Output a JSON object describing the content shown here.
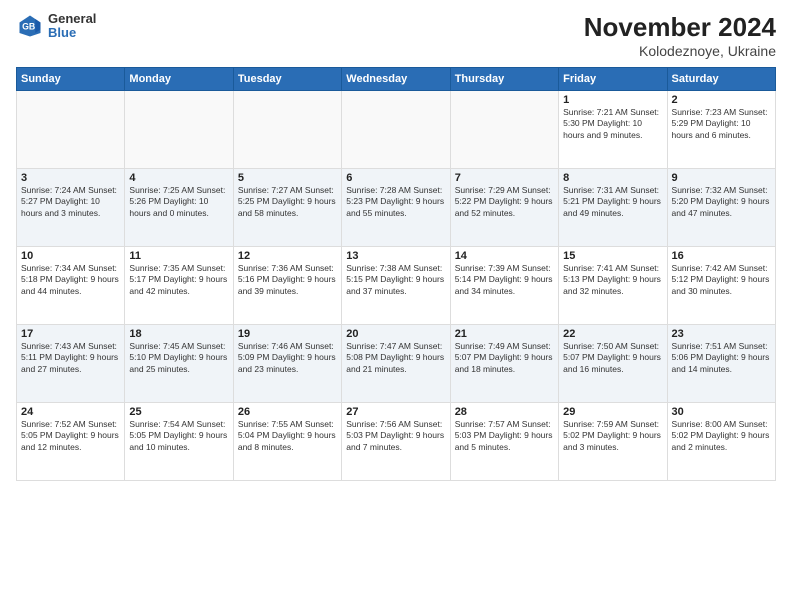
{
  "header": {
    "logo": {
      "general": "General",
      "blue": "Blue"
    },
    "title": "November 2024",
    "subtitle": "Kolodeznoye, Ukraine"
  },
  "days_of_week": [
    "Sunday",
    "Monday",
    "Tuesday",
    "Wednesday",
    "Thursday",
    "Friday",
    "Saturday"
  ],
  "weeks": [
    [
      {
        "day": "",
        "info": ""
      },
      {
        "day": "",
        "info": ""
      },
      {
        "day": "",
        "info": ""
      },
      {
        "day": "",
        "info": ""
      },
      {
        "day": "",
        "info": ""
      },
      {
        "day": "1",
        "info": "Sunrise: 7:21 AM\nSunset: 5:30 PM\nDaylight: 10 hours and 9 minutes."
      },
      {
        "day": "2",
        "info": "Sunrise: 7:23 AM\nSunset: 5:29 PM\nDaylight: 10 hours and 6 minutes."
      }
    ],
    [
      {
        "day": "3",
        "info": "Sunrise: 7:24 AM\nSunset: 5:27 PM\nDaylight: 10 hours and 3 minutes."
      },
      {
        "day": "4",
        "info": "Sunrise: 7:25 AM\nSunset: 5:26 PM\nDaylight: 10 hours and 0 minutes."
      },
      {
        "day": "5",
        "info": "Sunrise: 7:27 AM\nSunset: 5:25 PM\nDaylight: 9 hours and 58 minutes."
      },
      {
        "day": "6",
        "info": "Sunrise: 7:28 AM\nSunset: 5:23 PM\nDaylight: 9 hours and 55 minutes."
      },
      {
        "day": "7",
        "info": "Sunrise: 7:29 AM\nSunset: 5:22 PM\nDaylight: 9 hours and 52 minutes."
      },
      {
        "day": "8",
        "info": "Sunrise: 7:31 AM\nSunset: 5:21 PM\nDaylight: 9 hours and 49 minutes."
      },
      {
        "day": "9",
        "info": "Sunrise: 7:32 AM\nSunset: 5:20 PM\nDaylight: 9 hours and 47 minutes."
      }
    ],
    [
      {
        "day": "10",
        "info": "Sunrise: 7:34 AM\nSunset: 5:18 PM\nDaylight: 9 hours and 44 minutes."
      },
      {
        "day": "11",
        "info": "Sunrise: 7:35 AM\nSunset: 5:17 PM\nDaylight: 9 hours and 42 minutes."
      },
      {
        "day": "12",
        "info": "Sunrise: 7:36 AM\nSunset: 5:16 PM\nDaylight: 9 hours and 39 minutes."
      },
      {
        "day": "13",
        "info": "Sunrise: 7:38 AM\nSunset: 5:15 PM\nDaylight: 9 hours and 37 minutes."
      },
      {
        "day": "14",
        "info": "Sunrise: 7:39 AM\nSunset: 5:14 PM\nDaylight: 9 hours and 34 minutes."
      },
      {
        "day": "15",
        "info": "Sunrise: 7:41 AM\nSunset: 5:13 PM\nDaylight: 9 hours and 32 minutes."
      },
      {
        "day": "16",
        "info": "Sunrise: 7:42 AM\nSunset: 5:12 PM\nDaylight: 9 hours and 30 minutes."
      }
    ],
    [
      {
        "day": "17",
        "info": "Sunrise: 7:43 AM\nSunset: 5:11 PM\nDaylight: 9 hours and 27 minutes."
      },
      {
        "day": "18",
        "info": "Sunrise: 7:45 AM\nSunset: 5:10 PM\nDaylight: 9 hours and 25 minutes."
      },
      {
        "day": "19",
        "info": "Sunrise: 7:46 AM\nSunset: 5:09 PM\nDaylight: 9 hours and 23 minutes."
      },
      {
        "day": "20",
        "info": "Sunrise: 7:47 AM\nSunset: 5:08 PM\nDaylight: 9 hours and 21 minutes."
      },
      {
        "day": "21",
        "info": "Sunrise: 7:49 AM\nSunset: 5:07 PM\nDaylight: 9 hours and 18 minutes."
      },
      {
        "day": "22",
        "info": "Sunrise: 7:50 AM\nSunset: 5:07 PM\nDaylight: 9 hours and 16 minutes."
      },
      {
        "day": "23",
        "info": "Sunrise: 7:51 AM\nSunset: 5:06 PM\nDaylight: 9 hours and 14 minutes."
      }
    ],
    [
      {
        "day": "24",
        "info": "Sunrise: 7:52 AM\nSunset: 5:05 PM\nDaylight: 9 hours and 12 minutes."
      },
      {
        "day": "25",
        "info": "Sunrise: 7:54 AM\nSunset: 5:05 PM\nDaylight: 9 hours and 10 minutes."
      },
      {
        "day": "26",
        "info": "Sunrise: 7:55 AM\nSunset: 5:04 PM\nDaylight: 9 hours and 8 minutes."
      },
      {
        "day": "27",
        "info": "Sunrise: 7:56 AM\nSunset: 5:03 PM\nDaylight: 9 hours and 7 minutes."
      },
      {
        "day": "28",
        "info": "Sunrise: 7:57 AM\nSunset: 5:03 PM\nDaylight: 9 hours and 5 minutes."
      },
      {
        "day": "29",
        "info": "Sunrise: 7:59 AM\nSunset: 5:02 PM\nDaylight: 9 hours and 3 minutes."
      },
      {
        "day": "30",
        "info": "Sunrise: 8:00 AM\nSunset: 5:02 PM\nDaylight: 9 hours and 2 minutes."
      }
    ]
  ]
}
